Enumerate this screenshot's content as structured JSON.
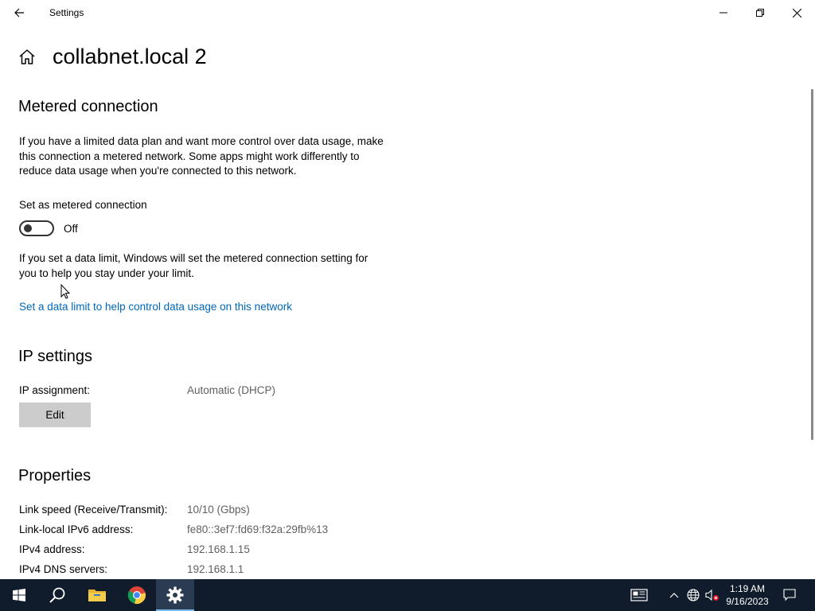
{
  "window": {
    "title": "Settings"
  },
  "page": {
    "title": "collabnet.local 2"
  },
  "metered": {
    "heading": "Metered connection",
    "description": "If you have a limited data plan and want more control over data usage, make this connection a metered network. Some apps might work differently to reduce data usage when you're connected to this network.",
    "toggle_label": "Set as metered connection",
    "toggle_state": "Off",
    "limit_description": "If you set a data limit, Windows will set the metered connection setting for you to help you stay under your limit.",
    "limit_link": "Set a data limit to help control data usage on this network"
  },
  "ip_settings": {
    "heading": "IP settings",
    "assignment_label": "IP assignment:",
    "assignment_value": "Automatic (DHCP)",
    "edit_label": "Edit"
  },
  "properties": {
    "heading": "Properties",
    "rows": [
      {
        "label": "Link speed (Receive/Transmit):",
        "value": "10/10 (Gbps)"
      },
      {
        "label": "Link-local IPv6 address:",
        "value": "fe80::3ef7:fd69:f32a:29fb%13"
      },
      {
        "label": "IPv4 address:",
        "value": "192.168.1.15"
      },
      {
        "label": "IPv4 DNS servers:",
        "value": "192.168.1.1"
      }
    ]
  },
  "taskbar": {
    "time": "1:19 AM",
    "date": "9/16/2023",
    "items": [
      "start-icon",
      "search-icon",
      "file-explorer-icon",
      "chrome-icon",
      "settings-icon"
    ],
    "tray": [
      "news-icon",
      "chevron-up-icon",
      "network-globe-icon",
      "volume-muted-icon",
      "notification-icon"
    ]
  },
  "colors": {
    "link": "#0067b8",
    "taskbar": "#101c2c",
    "button": "#cccccc"
  }
}
